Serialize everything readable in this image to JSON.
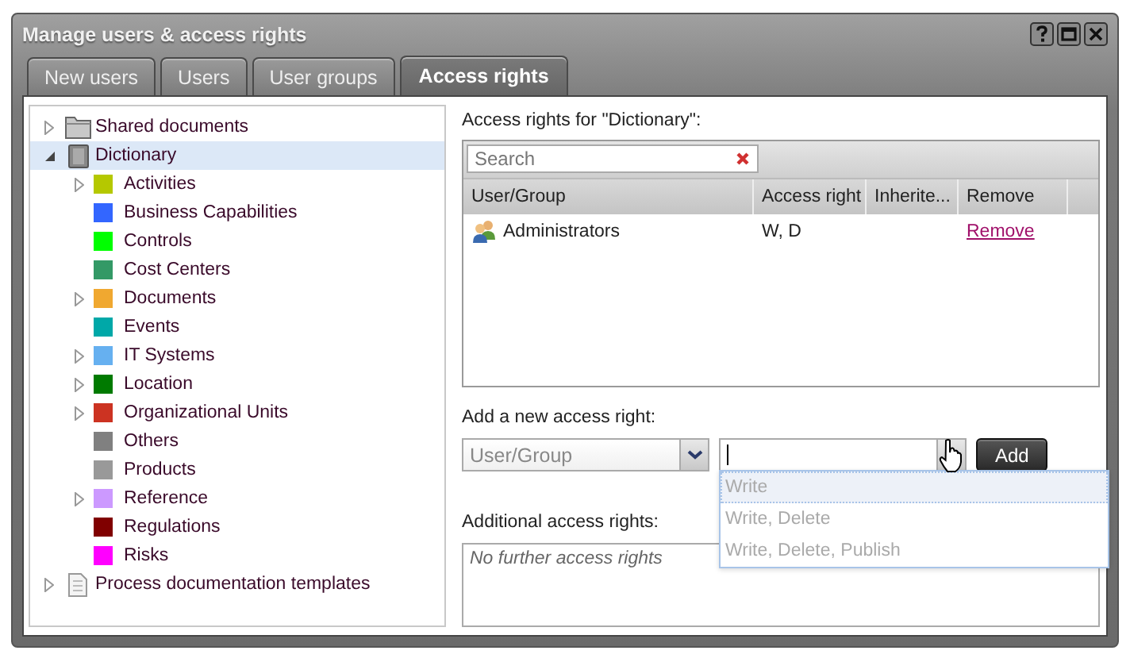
{
  "window": {
    "title": "Manage users & access rights"
  },
  "tabs": [
    {
      "label": "New users",
      "selected": false
    },
    {
      "label": "Users",
      "selected": false
    },
    {
      "label": "User groups",
      "selected": false
    },
    {
      "label": "Access rights",
      "selected": true
    }
  ],
  "tree": {
    "items": [
      {
        "label": "Shared documents",
        "kind": "folder",
        "has_children": true,
        "expanded": false,
        "selected": false
      },
      {
        "label": "Dictionary",
        "kind": "book",
        "has_children": true,
        "expanded": true,
        "selected": true,
        "children": [
          {
            "label": "Activities",
            "kind": "category",
            "color": "#b5c800",
            "has_children": true,
            "expanded": false,
            "selected": false
          },
          {
            "label": "Business Capabilities",
            "kind": "category",
            "color": "#3366ff",
            "has_children": false,
            "selected": false
          },
          {
            "label": "Controls",
            "kind": "category",
            "color": "#00ff00",
            "has_children": false,
            "selected": false
          },
          {
            "label": "Cost Centers",
            "kind": "category",
            "color": "#339966",
            "has_children": false,
            "selected": false
          },
          {
            "label": "Documents",
            "kind": "category",
            "color": "#f0a830",
            "has_children": true,
            "expanded": false,
            "selected": false
          },
          {
            "label": "Events",
            "kind": "category",
            "color": "#00a8a8",
            "has_children": false,
            "selected": false
          },
          {
            "label": "IT Systems",
            "kind": "category",
            "color": "#66b0f0",
            "has_children": true,
            "expanded": false,
            "selected": false
          },
          {
            "label": "Location",
            "kind": "category",
            "color": "#007a00",
            "has_children": true,
            "expanded": false,
            "selected": false
          },
          {
            "label": "Organizational Units",
            "kind": "category",
            "color": "#cc3322",
            "has_children": true,
            "expanded": false,
            "selected": false
          },
          {
            "label": "Others",
            "kind": "category",
            "color": "#808080",
            "has_children": false,
            "selected": false
          },
          {
            "label": "Products",
            "kind": "category",
            "color": "#999999",
            "has_children": false,
            "selected": false
          },
          {
            "label": "Reference",
            "kind": "category",
            "color": "#cc99ff",
            "has_children": true,
            "expanded": false,
            "selected": false
          },
          {
            "label": "Regulations",
            "kind": "category",
            "color": "#800000",
            "has_children": false,
            "selected": false
          },
          {
            "label": "Risks",
            "kind": "category",
            "color": "#ff00ff",
            "has_children": false,
            "selected": false
          }
        ]
      },
      {
        "label": "Process documentation templates",
        "kind": "document",
        "has_children": true,
        "expanded": false,
        "selected": false
      }
    ]
  },
  "access": {
    "label": "Access rights for \"Dictionary\":",
    "search": {
      "placeholder": "Search"
    },
    "columns": [
      "User/Group",
      "Access right",
      "Inherite...",
      "Remove"
    ],
    "rows": [
      {
        "user_group": "Administrators",
        "access_right": "W, D",
        "remove": "Remove"
      }
    ]
  },
  "add": {
    "label": "Add a new access right:",
    "user_select": {
      "placeholder": "User/Group"
    },
    "right_combo": {
      "focused": true
    },
    "options": [
      {
        "label": "Write",
        "selected": true,
        "disabled": true
      },
      {
        "label": "Write, Delete",
        "selected": false,
        "disabled": true
      },
      {
        "label": "Write, Delete, Publish",
        "selected": false,
        "disabled": true
      }
    ],
    "button": "Add"
  },
  "additional": {
    "label": "Additional access rights:",
    "empty_text": "No further access rights"
  }
}
